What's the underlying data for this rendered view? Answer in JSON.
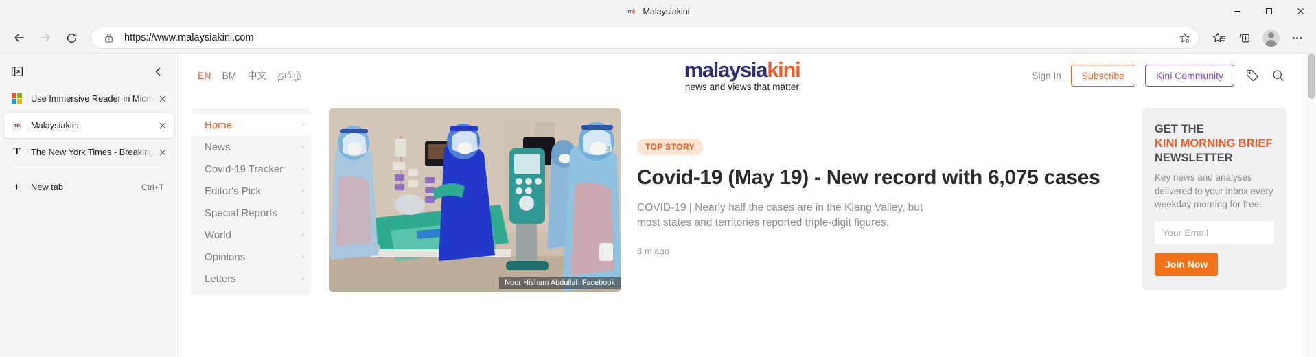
{
  "window": {
    "title": "Malaysiakini",
    "favicon_text": "mk",
    "minimize": "─",
    "maximize": "❐",
    "close": "✕"
  },
  "toolbar": {
    "back_icon": "back-arrow",
    "forward_icon": "forward-arrow",
    "refresh_icon": "refresh",
    "url": "https://www.malaysiakini.com",
    "lock_icon": "lock",
    "add_favorite_icon": "star-plus",
    "favorites_icon": "favorites-star-list",
    "collections_icon": "collections-plus",
    "profile_icon": "profile-avatar",
    "settings_icon": "ellipsis"
  },
  "vertical_tabs": {
    "tab_actions_icon": "tab-actions",
    "collapse_icon": "‹",
    "tabs": [
      {
        "title": "Use Immersive Reader in Microso",
        "favicon": "microsoft-logo",
        "active": false
      },
      {
        "title": "Malaysiakini",
        "favicon": "mk",
        "active": true
      },
      {
        "title": "The New York Times - Breaking N",
        "favicon": "nyt-t",
        "active": false
      }
    ],
    "close_glyph": "✕",
    "new_tab": {
      "label": "New tab",
      "shortcut": "Ctrl+T",
      "plus": "+"
    }
  },
  "site": {
    "languages": [
      {
        "label": "EN",
        "active": true
      },
      {
        "label": "BM",
        "active": false
      },
      {
        "label": "中文",
        "active": false
      },
      {
        "label": "தமிழ்",
        "active": false
      }
    ],
    "logo": {
      "part1": "malaysia",
      "part2": "kini",
      "tagline": "news and views that matter"
    },
    "header_actions": {
      "sign_in": "Sign In",
      "subscribe": "Subscribe",
      "kini_community": "Kini Community",
      "tag_icon": "tag",
      "search_icon": "search"
    },
    "nav": [
      {
        "label": "Home",
        "active": true
      },
      {
        "label": "News",
        "active": false
      },
      {
        "label": "Covid-19 Tracker",
        "active": false
      },
      {
        "label": "Editor's Pick",
        "active": false
      },
      {
        "label": "Special Reports",
        "active": false
      },
      {
        "label": "World",
        "active": false
      },
      {
        "label": "Opinions",
        "active": false
      },
      {
        "label": "Letters",
        "active": false
      }
    ],
    "nav_chevron": "›",
    "story": {
      "badge": "TOP STORY",
      "headline": "Covid-19 (May 19) - New record with 6,075 cases",
      "summary": "COVID-19 | Nearly half the cases are in the Klang Valley, but most states and territories reported triple-digit figures.",
      "timeago": "8 m ago",
      "image_caption": "Noor Hisham Abdullah Facebook"
    },
    "newsletter": {
      "line1": "GET THE",
      "line2": "KINI MORNING BRIEF",
      "line3": "NEWSLETTER",
      "body": "Key news and analyses delivered to your inbox every weekday morning for free.",
      "email_placeholder": "Your Email",
      "email_value": "",
      "join_button": "Join Now"
    }
  },
  "colors": {
    "accent_orange": "#f15a24",
    "brand_navy": "#2d2e70",
    "community_purple": "#7c4dc4",
    "join_orange": "#f2721a"
  }
}
